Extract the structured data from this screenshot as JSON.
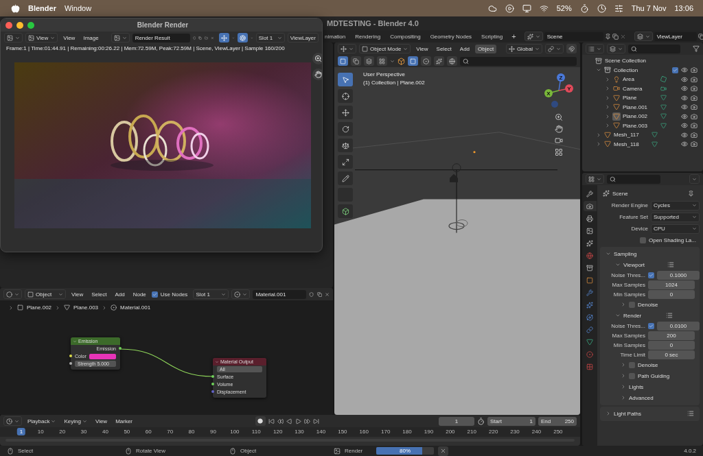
{
  "menubar": {
    "app": "Blender",
    "menus": [
      "Window"
    ],
    "battery": "52%",
    "date": "Thu 7 Nov",
    "time": "13:06"
  },
  "window": {
    "title": "MDTESTING - Blender 4.0"
  },
  "workspace_tabs": [
    {
      "label": "nimation",
      "selected": false
    },
    {
      "label": "Rendering",
      "selected": false
    },
    {
      "label": "Compositing",
      "selected": false
    },
    {
      "label": "Geometry Nodes",
      "selected": false
    },
    {
      "label": "Scripting",
      "selected": false
    }
  ],
  "add_workspace": "+",
  "scene": "Scene",
  "view_layer": "ViewLayer",
  "render_window": {
    "title": "Blender Render",
    "view_dropdown": "View",
    "menus": [
      "View",
      "Image"
    ],
    "image": "Render Result",
    "slot": "Slot 1",
    "layer": "ViewLayer",
    "info": "Frame:1 | Time:01:44.91 | Remaining:00:26.22 | Mem:72.59M, Peak:72.59M | Scene, ViewLayer | Sample 160/200"
  },
  "viewport": {
    "mode": "Object Mode",
    "menus": [
      {
        "label": "View",
        "selected": false
      },
      {
        "label": "Select",
        "selected": false
      },
      {
        "label": "Add",
        "selected": false
      },
      {
        "label": "Object",
        "selected": true
      }
    ],
    "orientation": "Global",
    "overlay_lines": [
      "User Perspective",
      "(1) Collection | Plane.002"
    ],
    "axes": [
      "Z",
      "Y",
      "X"
    ]
  },
  "outliner": {
    "tree": [
      {
        "label": "Scene Collection",
        "kind": "scene",
        "children": [
          {
            "label": "Collection",
            "kind": "collection",
            "expanded": true,
            "checked": true,
            "selected": false,
            "children": [
              {
                "label": "Area",
                "kind": "light",
                "expanded": false,
                "selected": false
              },
              {
                "label": "Camera",
                "kind": "camera",
                "expanded": false,
                "selected": false
              },
              {
                "label": "Plane",
                "kind": "mesh",
                "expanded": false,
                "selected": false
              },
              {
                "label": "Plane.001",
                "kind": "mesh",
                "expanded": false,
                "selected": false
              },
              {
                "label": "Plane.002",
                "kind": "mesh",
                "expanded": false,
                "selected": true
              },
              {
                "label": "Plane.003",
                "kind": "mesh",
                "expanded": false,
                "selected": false
              }
            ]
          },
          {
            "label": "Mesh_117",
            "kind": "mesh",
            "expanded": false,
            "selected": false
          },
          {
            "label": "Mesh_118",
            "kind": "mesh",
            "expanded": false,
            "selected": false
          }
        ]
      }
    ]
  },
  "properties": {
    "tabs": [
      {
        "kind": "tool",
        "selected": false
      },
      {
        "kind": "render",
        "selected": true
      },
      {
        "kind": "output",
        "selected": false
      },
      {
        "kind": "view_layer",
        "selected": false
      },
      {
        "kind": "scene",
        "selected": false
      },
      {
        "kind": "world",
        "selected": false
      },
      {
        "kind": "collection",
        "selected": false
      },
      {
        "kind": "object",
        "selected": false
      },
      {
        "kind": "modifier",
        "selected": false
      },
      {
        "kind": "particles",
        "selected": false
      },
      {
        "kind": "physics",
        "selected": false
      },
      {
        "kind": "constraints",
        "selected": false
      },
      {
        "kind": "data",
        "selected": false
      },
      {
        "kind": "material",
        "selected": false
      },
      {
        "kind": "texture",
        "selected": false
      }
    ],
    "context": "Scene",
    "fields": [
      {
        "label": "Render Engine",
        "value": "Cycles"
      },
      {
        "label": "Feature Set",
        "value": "Supported"
      },
      {
        "label": "Device",
        "value": "CPU"
      }
    ],
    "osl": {
      "label": "Open Shading La...",
      "checked": false
    },
    "panels": [
      {
        "label": "Sampling",
        "expanded": true,
        "items": [
          {
            "kind": "section",
            "label": "Viewport",
            "expanded": true
          },
          {
            "kind": "check_number",
            "label": "Noise Thres...",
            "checked": true,
            "value": "0.1000"
          },
          {
            "kind": "number",
            "label": "Max Samples",
            "value": "1024"
          },
          {
            "kind": "number",
            "label": "Min Samples",
            "value": "0"
          },
          {
            "kind": "sub_check",
            "label": "Denoise",
            "expanded": false,
            "checked": false
          },
          {
            "kind": "section",
            "label": "Render",
            "expanded": true
          },
          {
            "kind": "check_number",
            "label": "Noise Thres...",
            "checked": true,
            "value": "0.0100"
          },
          {
            "kind": "number",
            "label": "Max Samples",
            "value": "200"
          },
          {
            "kind": "number",
            "label": "Min Samples",
            "value": "0"
          },
          {
            "kind": "number",
            "label": "Time Limit",
            "value": "0 sec"
          },
          {
            "kind": "sub_check",
            "label": "Denoise",
            "expanded": false,
            "checked": false
          },
          {
            "kind": "sub_check",
            "label": "Path Guiding",
            "expanded": false,
            "checked": false
          },
          {
            "kind": "sub",
            "label": "Lights",
            "expanded": false
          },
          {
            "kind": "sub",
            "label": "Advanced",
            "expanded": false
          }
        ]
      },
      {
        "label": "Light Paths",
        "expanded": false
      }
    ]
  },
  "node_editor": {
    "object": "Object",
    "menus": [
      "View",
      "Select",
      "Add",
      "Node"
    ],
    "use_nodes": {
      "label": "Use Nodes",
      "checked": true
    },
    "slot": "Slot 1",
    "material": "Material.001",
    "breadcrumbs": [
      {
        "kind": "object",
        "label": "Plane.002"
      },
      {
        "kind": "mesh",
        "label": "Plane.003"
      },
      {
        "kind": "material",
        "label": "Material.001"
      }
    ],
    "emission": {
      "title": "Emission",
      "output": "Emission",
      "color_label": "Color",
      "color": "#e834b8",
      "strength_label": "Strength",
      "strength": "5.000"
    },
    "output": {
      "title": "Material Output",
      "target": "All",
      "inputs": [
        "Surface",
        "Volume",
        "Displacement"
      ]
    }
  },
  "timeline": {
    "menus": [
      {
        "label": "Playback",
        "dropdown": true
      },
      {
        "label": "Keying",
        "dropdown": true
      },
      {
        "label": "View",
        "dropdown": false
      },
      {
        "label": "Marker",
        "dropdown": false
      }
    ],
    "current_frame": "1",
    "start_label": "Start",
    "start": "1",
    "end_label": "End",
    "end": "250",
    "ticks": [
      {
        "label": "1",
        "selected": true
      },
      {
        "label": "10",
        "selected": false
      },
      {
        "label": "20",
        "selected": false
      },
      {
        "label": "30",
        "selected": false
      },
      {
        "label": "40",
        "selected": false
      },
      {
        "label": "50",
        "selected": false
      },
      {
        "label": "60",
        "selected": false
      },
      {
        "label": "70",
        "selected": false
      },
      {
        "label": "80",
        "selected": false
      },
      {
        "label": "90",
        "selected": false
      },
      {
        "label": "100",
        "selected": false
      },
      {
        "label": "110",
        "selected": false
      },
      {
        "label": "120",
        "selected": false
      },
      {
        "label": "130",
        "selected": false
      },
      {
        "label": "140",
        "selected": false
      },
      {
        "label": "150",
        "selected": false
      },
      {
        "label": "160",
        "selected": false
      },
      {
        "label": "170",
        "selected": false
      },
      {
        "label": "180",
        "selected": false
      },
      {
        "label": "190",
        "selected": false
      },
      {
        "label": "200",
        "selected": false
      },
      {
        "label": "210",
        "selected": false
      },
      {
        "label": "220",
        "selected": false
      },
      {
        "label": "230",
        "selected": false
      },
      {
        "label": "240",
        "selected": false
      },
      {
        "label": "250",
        "selected": false
      }
    ]
  },
  "status_bar": {
    "hints": [
      "Select",
      "Rotate View",
      "Object"
    ],
    "job": "Render",
    "progress": {
      "level": 0.8,
      "reading": "80%"
    },
    "version": "4.0.2"
  }
}
